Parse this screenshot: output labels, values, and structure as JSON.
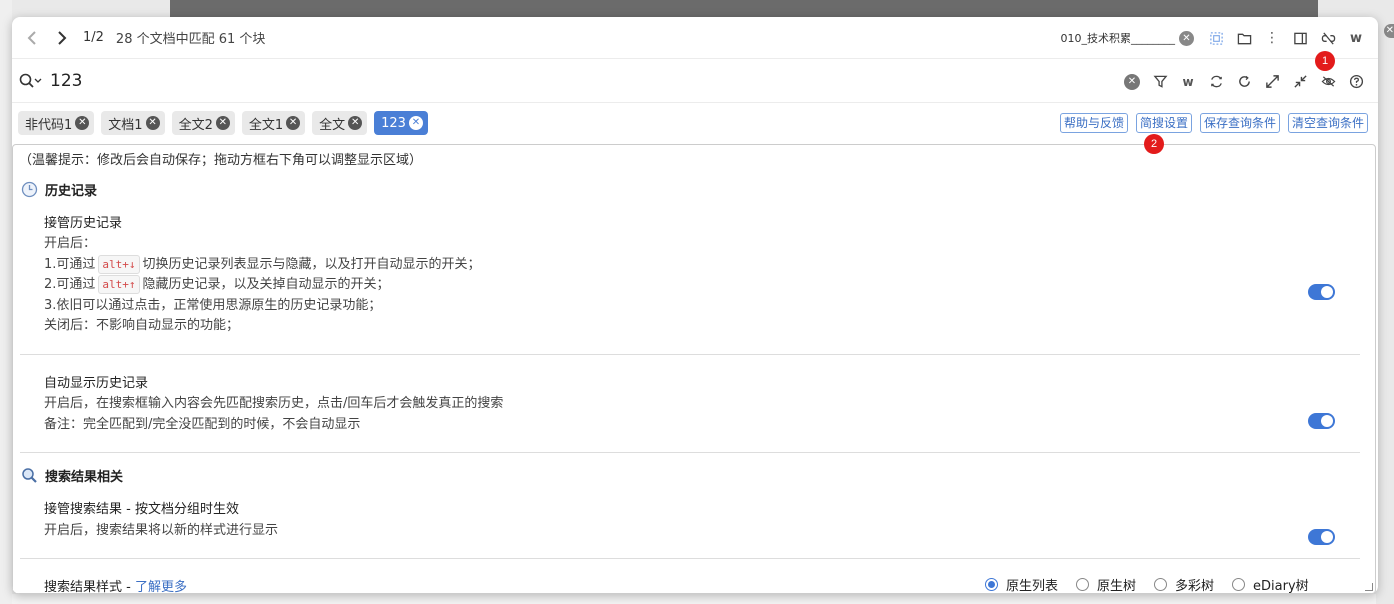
{
  "toolbar": {
    "pager": "1/2",
    "match_summary": "28 个文档中匹配 61 个块",
    "notebook": "010_技术积累________",
    "w_label": "w"
  },
  "search": {
    "query": "123",
    "w_label": "w"
  },
  "badges": [
    "1",
    "2"
  ],
  "tags": [
    {
      "label": "非代码1",
      "selected": false
    },
    {
      "label": "文档1",
      "selected": false
    },
    {
      "label": "全文2",
      "selected": false
    },
    {
      "label": "全文1",
      "selected": false
    },
    {
      "label": "全文",
      "selected": false
    },
    {
      "label": "123",
      "selected": true
    }
  ],
  "actions": {
    "help": "帮助与反馈",
    "settings": "简搜设置",
    "save_query": "保存查询条件",
    "clear_query": "清空查询条件"
  },
  "panel": {
    "tip": "（温馨提示：修改后会自动保存；拖动方框右下角可以调整显示区域）",
    "history_section": "历史记录",
    "history_takeover": {
      "title": "接管历史记录",
      "line1": "开启后：",
      "line2_pre": "1.可通过",
      "line2_kbd": "alt+↓",
      "line2_post": "切换历史记录列表显示与隐藏，以及打开自动显示的开关；",
      "line3_pre": "2.可通过",
      "line3_kbd": "alt+↑",
      "line3_post": "隐藏历史记录，以及关掉自动显示的开关；",
      "line4": "3.依旧可以通过点击，正常使用思源原生的历史记录功能；",
      "line5": "关闭后：不影响自动显示的功能；",
      "enabled": true
    },
    "auto_history": {
      "title": "自动显示历史记录",
      "line1": "开启后，在搜索框输入内容会先匹配搜索历史，点击/回车后才会触发真正的搜索",
      "line2": "备注：完全匹配到/完全没匹配到的时候，不会自动显示",
      "enabled": true
    },
    "results_section": "搜索结果相关",
    "results_takeover": {
      "title": "接管搜索结果 - 按文档分组时生效",
      "line1": "开启后，搜索结果将以新的样式进行显示",
      "enabled": true
    },
    "results_style": {
      "title": "搜索结果样式 - ",
      "learn_more": "了解更多",
      "options": [
        "原生列表",
        "原生树",
        "多彩树",
        "eDiary树"
      ],
      "selected": "原生列表"
    }
  }
}
